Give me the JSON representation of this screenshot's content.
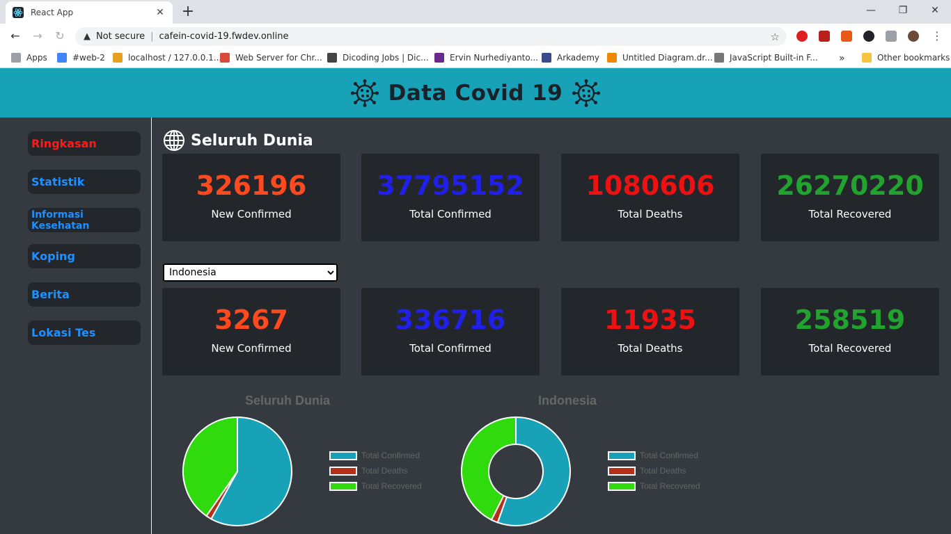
{
  "browser": {
    "tab_title": "React App",
    "security_label": "Not secure",
    "url": "cafein-covid-19.fwdev.online",
    "bookmarks": [
      {
        "label": "Apps"
      },
      {
        "label": "#web-2"
      },
      {
        "label": "localhost / 127.0.0.1..."
      },
      {
        "label": "Web Server for Chr..."
      },
      {
        "label": "Dicoding Jobs | Dic..."
      },
      {
        "label": "Ervin Nurhediyanto..."
      },
      {
        "label": "Arkademy"
      },
      {
        "label": "Untitled Diagram.dr..."
      },
      {
        "label": "JavaScript Built-in F..."
      }
    ],
    "overflow_label": "»",
    "other_bookmarks": "Other bookmarks"
  },
  "header": {
    "title": "Data Covid 19"
  },
  "sidebar": {
    "items": [
      {
        "label": "Ringkasan",
        "active": true
      },
      {
        "label": "Statistik"
      },
      {
        "label": "Informasi Kesehatan"
      },
      {
        "label": "Koping"
      },
      {
        "label": "Berita"
      },
      {
        "label": "Lokasi Tes"
      }
    ]
  },
  "world": {
    "title": "Seluruh Dunia",
    "stats": [
      {
        "value": "326196",
        "label": "New Confirmed",
        "color": "#ff4a1f"
      },
      {
        "value": "37795152",
        "label": "Total Confirmed",
        "color": "#2020e8"
      },
      {
        "value": "1080606",
        "label": "Total Deaths",
        "color": "#ee1111"
      },
      {
        "value": "26270220",
        "label": "Total Recovered",
        "color": "#22a22e"
      }
    ]
  },
  "country": {
    "selected": "Indonesia",
    "stats": [
      {
        "value": "3267",
        "label": "New Confirmed",
        "color": "#ff4a1f"
      },
      {
        "value": "336716",
        "label": "Total Confirmed",
        "color": "#2020e8"
      },
      {
        "value": "11935",
        "label": "Total Deaths",
        "color": "#ee1111"
      },
      {
        "value": "258519",
        "label": "Total Recovered",
        "color": "#22a22e"
      }
    ]
  },
  "chart_data": [
    {
      "type": "pie",
      "title": "Seluruh Dunia",
      "categories": [
        "Total Confirmed",
        "Total Deaths",
        "Total Recovered"
      ],
      "values": [
        37795152,
        1080606,
        26270220
      ],
      "colors": [
        "#17a2b8",
        "#b52f1a",
        "#2fdb0c"
      ],
      "legend": "right"
    },
    {
      "type": "doughnut",
      "title": "Indonesia",
      "categories": [
        "Total Confirmed",
        "Total Deaths",
        "Total Recovered"
      ],
      "values": [
        336716,
        11935,
        258519
      ],
      "colors": [
        "#17a2b8",
        "#b52f1a",
        "#2fdb0c"
      ],
      "legend": "right"
    }
  ]
}
